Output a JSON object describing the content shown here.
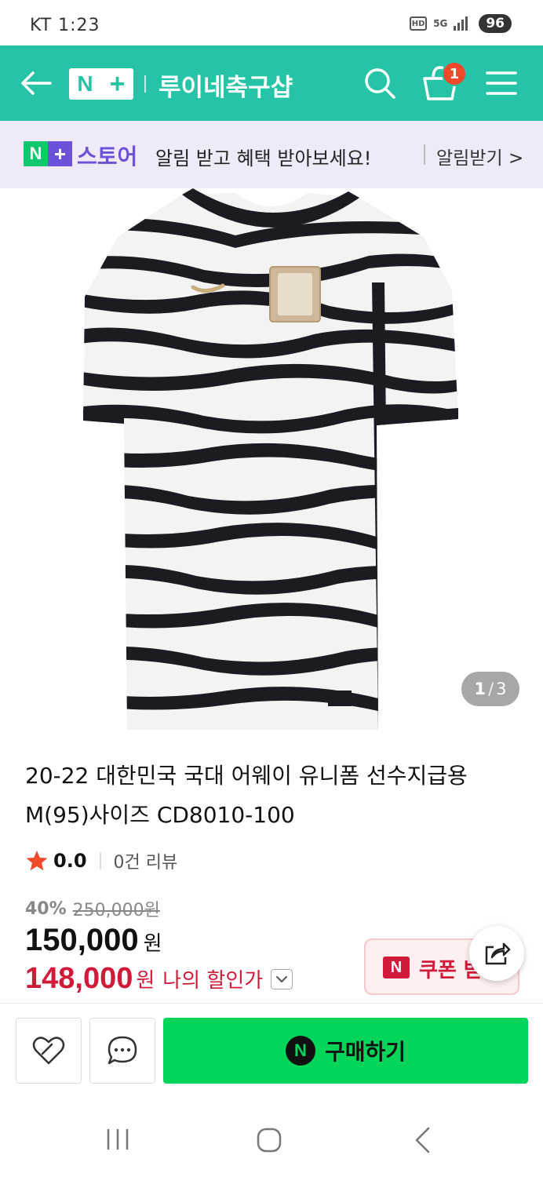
{
  "status_bar": {
    "carrier_time": "KT 1:23",
    "hd_label": "HD",
    "network": "5G",
    "battery": "96"
  },
  "header": {
    "logo_n": "N",
    "logo_plus": "+",
    "store_name": "루이네축구샵",
    "cart_count": "1",
    "icons": [
      "back-arrow-icon",
      "search-icon",
      "cart-icon",
      "menu-icon"
    ],
    "bg_color": "#26c4a6"
  },
  "banner": {
    "logo_n": "N",
    "logo_plus": "+",
    "store_label": "스토어",
    "message": "알림 받고 혜택 받아보세요!",
    "action": "알림받기 >"
  },
  "gallery": {
    "current": "1",
    "separator": "/",
    "total": "3"
  },
  "product": {
    "title_line1": "20-22 대한민국 국대 어웨이 유니폼 선수지급용",
    "title_line2": "M(95)사이즈 CD8010-100",
    "rating": "0.0",
    "review_count": "0건 리뷰",
    "discount_rate": "40%",
    "original_price": "250,000원",
    "price": "150,000",
    "price_unit": "원",
    "my_price": "148,000",
    "my_price_unit": "원",
    "my_price_label": "나의 할인가",
    "coupon_n": "N",
    "coupon_label": "쿠폰 받",
    "accent_red": "#d11a3a"
  },
  "bottom_bar": {
    "buy_n": "N",
    "buy_label": "구매하기",
    "buy_color": "#03d55b",
    "icons": [
      "heart-icon",
      "chat-bubble-icon"
    ]
  },
  "navbar": {
    "icons": [
      "recents-icon",
      "home-icon",
      "back-icon"
    ]
  }
}
